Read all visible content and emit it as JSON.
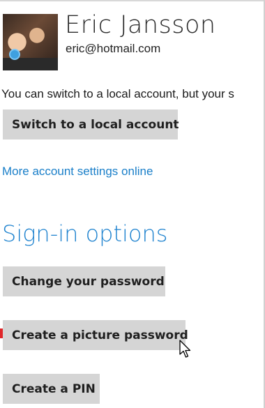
{
  "user": {
    "name": "Eric Jansson",
    "email": "eric@hotmail.com"
  },
  "account": {
    "info_text": "You can switch to a local account, but your s",
    "switch_button": "Switch to a local account",
    "more_settings_link": "More account settings online"
  },
  "signin": {
    "title": "Sign-in options",
    "change_password_button": "Change your password",
    "picture_password_button": "Create a picture password",
    "pin_button": "Create a PIN"
  },
  "colors": {
    "accent": "#1f83cf",
    "link": "#1a7fc9",
    "button_bg": "#d5d5d5",
    "marker": "#e0262a"
  }
}
